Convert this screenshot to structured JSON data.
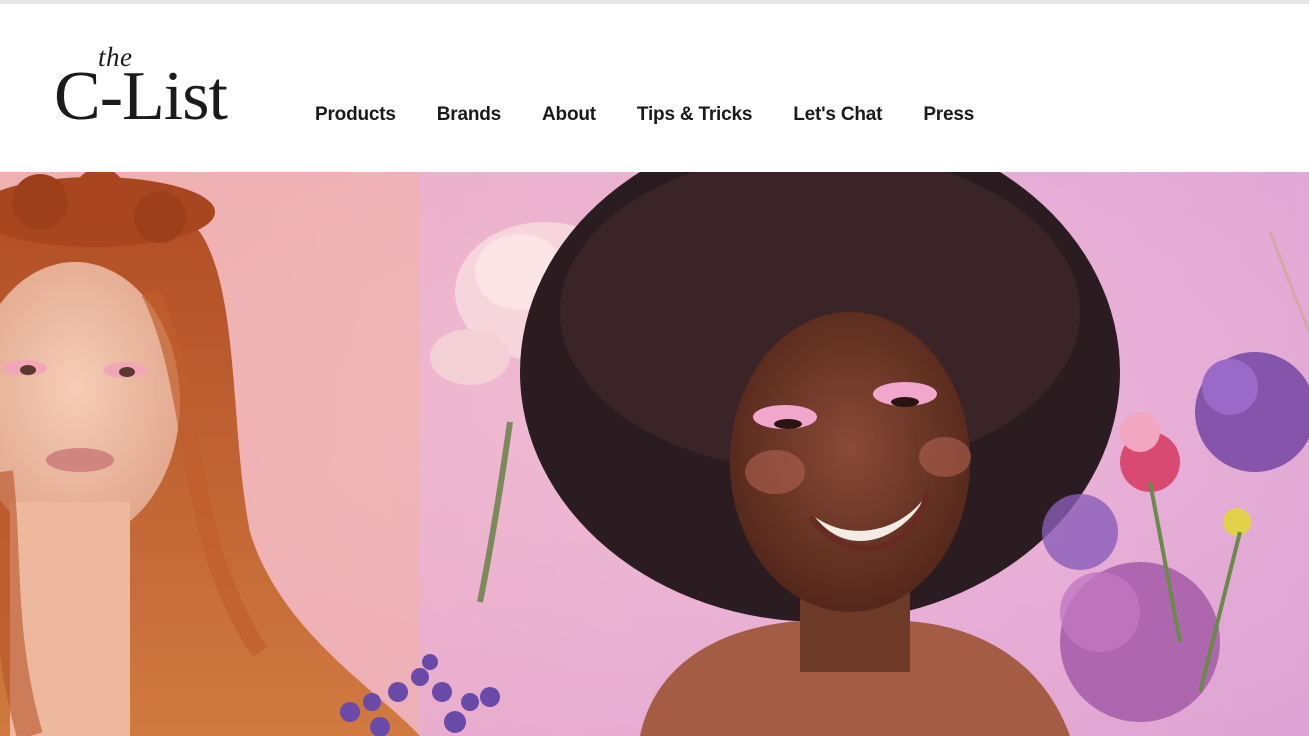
{
  "logo": {
    "the": "the",
    "main": "C-List"
  },
  "nav": {
    "items": [
      {
        "label": "Products"
      },
      {
        "label": "Brands"
      },
      {
        "label": "About"
      },
      {
        "label": "Tips & Tricks"
      },
      {
        "label": "Let's Chat"
      },
      {
        "label": "Press"
      }
    ]
  },
  "hero": {
    "image": "hero-photo-two-women-with-flowers",
    "colors": {
      "background": "#ecb0d2",
      "hair_red": "#b0502a",
      "hair_dark": "#2b1a1e",
      "skin_light": "#f0c0a8",
      "skin_dark": "#6b3a2a",
      "rose": "#f4d2d8",
      "hydrangea": "#8a5cb8"
    }
  }
}
